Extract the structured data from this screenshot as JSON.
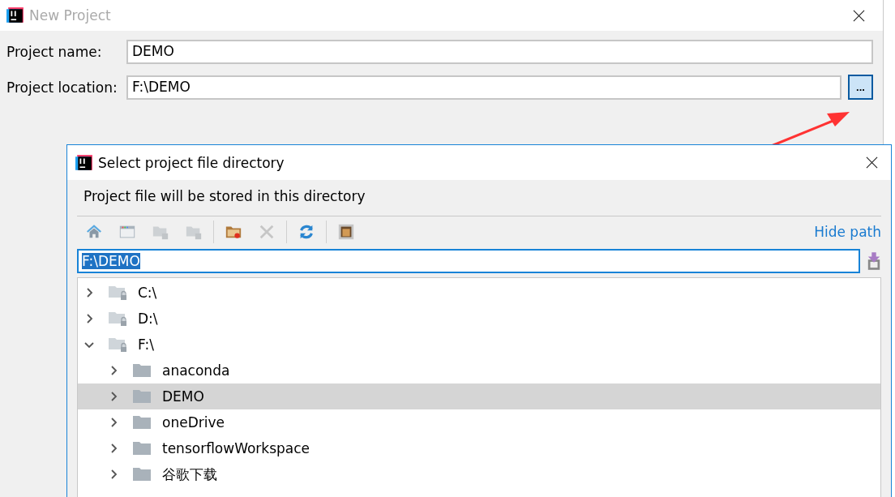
{
  "window": {
    "title": "New Project",
    "active": false
  },
  "fields": [
    {
      "label": "Project name:",
      "value": "DEMO",
      "browse": false
    },
    {
      "label": "Project location:",
      "value": "F:\\DEMO",
      "browse": true,
      "browse_label": "..."
    }
  ],
  "dialog": {
    "title": "Select project file directory",
    "description": "Project file will be stored in this directory",
    "toolbar": [
      [
        {
          "kind": "home",
          "disabled": false
        },
        {
          "kind": "desktop",
          "disabled": false
        },
        {
          "kind": "folder",
          "disabled": true
        },
        {
          "kind": "folder",
          "disabled": true
        }
      ],
      [
        {
          "kind": "new-folder",
          "disabled": false
        },
        {
          "kind": "delete",
          "disabled": true
        }
      ],
      [
        {
          "kind": "refresh",
          "disabled": false
        }
      ],
      [
        {
          "kind": "hidden-files",
          "disabled": false
        }
      ]
    ],
    "hide_path_link": "Hide path",
    "path": {
      "value": "F:\\DEMO",
      "text_selected": true
    },
    "tree": [
      {
        "name": "C:\\",
        "kind": "drive",
        "expanded": false,
        "selected": false
      },
      {
        "name": "D:\\",
        "kind": "drive",
        "expanded": false,
        "selected": false
      },
      {
        "name": "F:\\",
        "kind": "drive",
        "expanded": true,
        "selected": false,
        "children": [
          {
            "name": "anaconda",
            "kind": "folder",
            "expanded": false,
            "selected": false
          },
          {
            "name": "DEMO",
            "kind": "folder",
            "expanded": false,
            "selected": true
          },
          {
            "name": "oneDrive",
            "kind": "folder",
            "expanded": false,
            "selected": false
          },
          {
            "name": "tensorflowWorkspace",
            "kind": "folder",
            "expanded": false,
            "selected": false
          },
          {
            "name": "谷歌下载",
            "kind": "folder",
            "expanded": false,
            "selected": false
          }
        ]
      }
    ]
  }
}
